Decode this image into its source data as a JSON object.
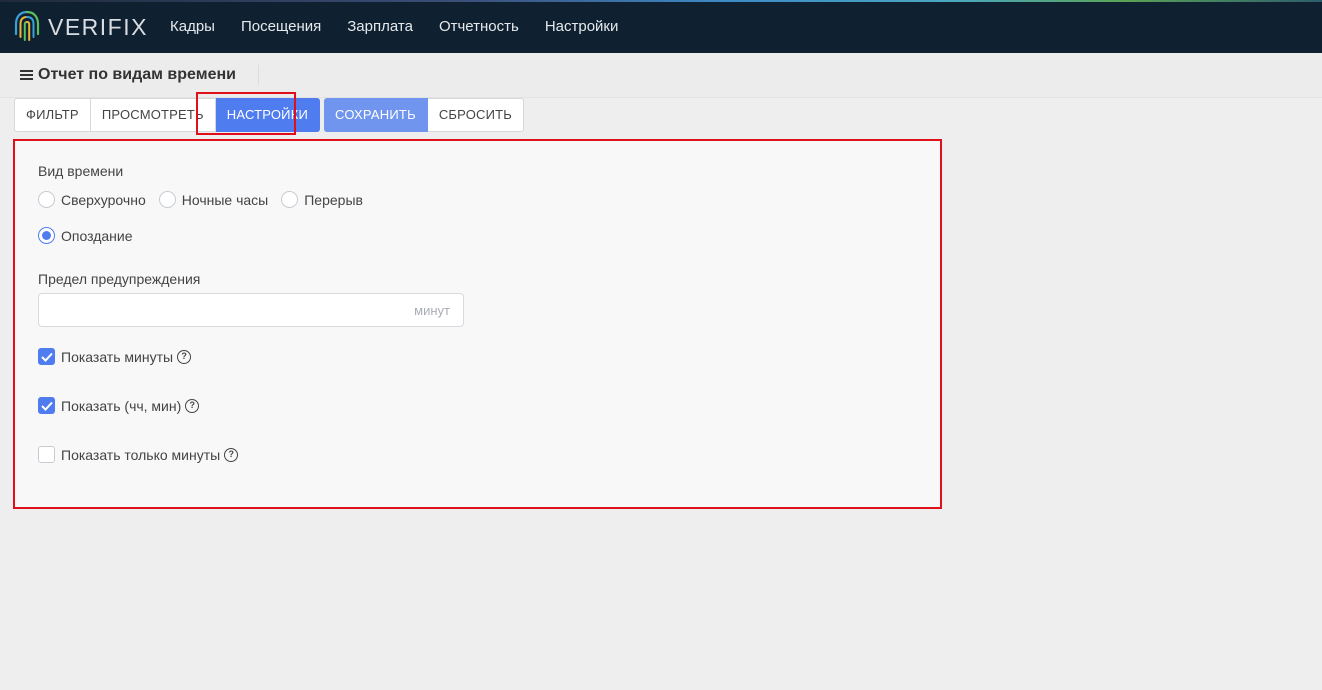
{
  "app": {
    "logo_text": "VERIFIX",
    "nav": [
      "Кадры",
      "Посещения",
      "Зарплата",
      "Отчетность",
      "Настройки"
    ]
  },
  "page": {
    "title": "Отчет по видам времени"
  },
  "toolbar": {
    "filter": "Фильтр",
    "view": "Просмотреть",
    "settings": "Настройки",
    "save": "Сохранить",
    "reset": "Сбросить",
    "active_tab": "settings"
  },
  "settings": {
    "time_kind_label": "Вид времени",
    "time_kinds": [
      {
        "label": "Сверхурочно",
        "selected": false
      },
      {
        "label": "Ночные часы",
        "selected": false
      },
      {
        "label": "Перерыв",
        "selected": false
      },
      {
        "label": "Опоздание",
        "selected": true
      }
    ],
    "warning_limit_label": "Предел предупреждения",
    "warning_limit_value": "",
    "warning_limit_unit": "минут",
    "checkboxes": [
      {
        "label": "Показать минуты",
        "checked": true
      },
      {
        "label": "Показать (чч, мин)",
        "checked": true
      },
      {
        "label": "Показать только минуты",
        "checked": false
      }
    ]
  },
  "colors": {
    "accent": "#4f7df0",
    "highlight": "#e0101a",
    "nav_bg": "#0f2130"
  }
}
